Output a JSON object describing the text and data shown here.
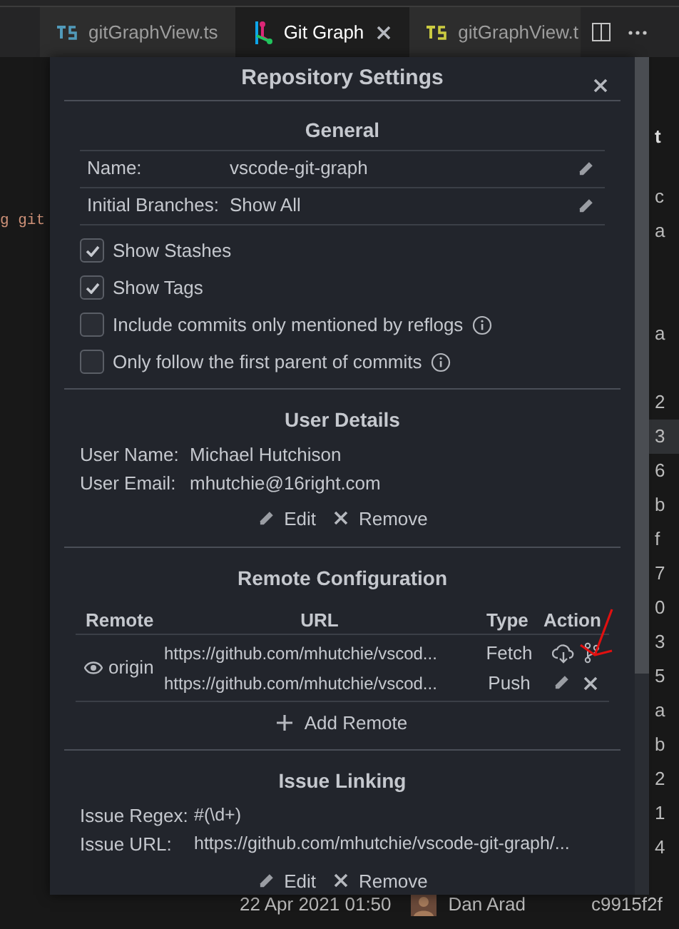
{
  "tabs": [
    {
      "label": "gitGraphView.ts",
      "kind": "ts",
      "selected": false
    },
    {
      "label": "Git Graph",
      "kind": "graph",
      "selected": true
    },
    {
      "label": "gitGraphView.t",
      "kind": "ts-modified",
      "selected": false
    }
  ],
  "editor": {
    "left_text": "g git",
    "right_header": "t",
    "right_rows": [
      {
        "text": "c",
        "selected": false
      },
      {
        "text": "a",
        "selected": false
      },
      {
        "selected": false
      },
      {
        "selected": false
      },
      {
        "text": "a",
        "selected": false
      },
      {
        "selected": false
      },
      {
        "text": "2",
        "selected": false
      },
      {
        "text": "3",
        "selected": true
      },
      {
        "text": "6",
        "selected": false
      },
      {
        "text": "b",
        "selected": false
      },
      {
        "text": "f",
        "selected": false
      },
      {
        "text": "7",
        "selected": false
      },
      {
        "text": "0",
        "selected": false
      },
      {
        "text": "3",
        "selected": false
      },
      {
        "text": "5",
        "selected": false
      },
      {
        "text": "a",
        "selected": false
      },
      {
        "text": "b",
        "selected": false
      },
      {
        "text": "2",
        "selected": false
      },
      {
        "text": "1",
        "selected": false
      },
      {
        "text": "4",
        "selected": false
      }
    ],
    "bottom_row": {
      "date": "22 Apr 2021 01:50",
      "author": "Dan Arad",
      "hash": "c9915f2f"
    }
  },
  "dialog": {
    "title": "Repository Settings",
    "general": {
      "heading": "General",
      "fields": [
        {
          "label": "Name:",
          "value": "vscode-git-graph"
        },
        {
          "label": "Initial Branches:",
          "value": "Show All"
        }
      ],
      "options": [
        {
          "label": "Show Stashes",
          "checked": true,
          "info": false
        },
        {
          "label": "Show Tags",
          "checked": true,
          "info": false
        },
        {
          "label": "Include commits only mentioned by reflogs",
          "checked": false,
          "info": true
        },
        {
          "label": "Only follow the first parent of commits",
          "checked": false,
          "info": true
        }
      ]
    },
    "user_details": {
      "heading": "User Details",
      "fields": [
        {
          "label": "User Name:",
          "value": "Michael Hutchison"
        },
        {
          "label": "User Email:",
          "value": "mhutchie@16right.com"
        }
      ],
      "actions": [
        "Edit",
        "Remove"
      ]
    },
    "remotes": {
      "heading": "Remote Configuration",
      "columns": [
        "Remote",
        "URL",
        "Type",
        "Action"
      ],
      "rows": [
        {
          "name": "origin",
          "urls": [
            {
              "url": "https://github.com/mhutchie/vscod...",
              "type": "Fetch"
            },
            {
              "url": "https://github.com/mhutchie/vscod...",
              "type": "Push"
            }
          ]
        }
      ],
      "add_label": "Add Remote"
    },
    "issue_linking": {
      "heading": "Issue Linking",
      "fields": [
        {
          "label": "Issue Regex:",
          "value": "#(\\d+)"
        },
        {
          "label": "Issue URL:",
          "value": "https://github.com/mhutchie/vscode-git-graph/..."
        }
      ],
      "actions": [
        "Edit",
        "Remove"
      ]
    }
  }
}
